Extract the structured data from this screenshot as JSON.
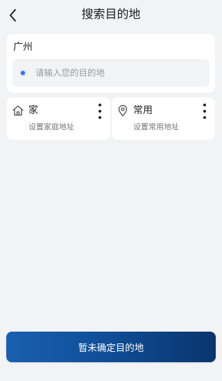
{
  "header": {
    "title": "搜索目的地",
    "back_icon": "chevron-left-icon"
  },
  "search": {
    "city": "广州",
    "placeholder": "请输入您的目的地",
    "dot_color": "#2f6df6"
  },
  "quick": [
    {
      "title": "家",
      "subtitle": "设置家庭地址",
      "icon": "home-icon"
    },
    {
      "title": "常用",
      "subtitle": "设置常用地址",
      "icon": "location-pin-icon"
    }
  ],
  "confirm_button": {
    "label": "暂未确定目的地",
    "gradient": [
      "#1a5fb0",
      "#0a356c"
    ]
  }
}
